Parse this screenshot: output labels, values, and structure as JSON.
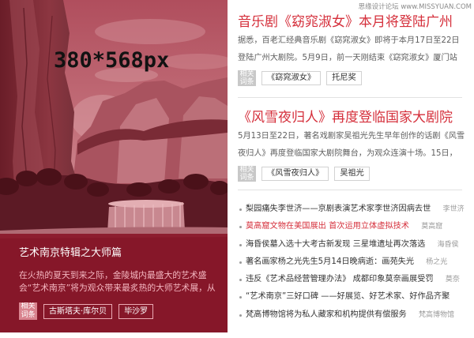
{
  "watermark": "思缘设计论坛 www.MISSYUAN.COM",
  "colors": {
    "accent": "#d52f3b",
    "caption_background": "#8a1729",
    "feature_tag_label": "#d9848f",
    "related_label": "#c8c8c8"
  },
  "feature": {
    "image_placeholder": "380*568px",
    "title": "艺术南京特辑之大师篇",
    "description_lines": [
      "在火热的夏天到来之际，金陵城内最盛大的艺术盛",
      "会“艺术南京”将为观众带来最炙热的大师艺术展，从"
    ],
    "related_label": "相关词条",
    "tags": [
      "古斯塔夫·库尔贝",
      "毕沙罗"
    ]
  },
  "articles": [
    {
      "title": "音乐剧《窈窕淑女》本月将登陆广州",
      "description_lines": [
        "据悉，百老汇经典音乐剧《窈窕淑女》即将于本月17日至22日",
        "登陆广州大剧院。5月9日，前一天刚结束《窈窕淑女》厦门站"
      ],
      "related_label": "相关词条",
      "tags": [
        "《窈窕淑女》",
        "托尼奖"
      ]
    },
    {
      "title": "《风雪夜归人》再度登临国家大剧院",
      "description_lines": [
        "5月13日至22日，著名戏剧家吴祖光先生早年创作的话剧《风雪",
        "夜归人》再度登临国家大剧院舞台，为观众连演十场。15日，"
      ],
      "related_label": "相关词条",
      "tags": [
        "《风雪夜归人》",
        "吴祖光"
      ]
    }
  ],
  "news_list": [
    {
      "title": "梨园痛失李世济——京剧表演艺术家李世济因病去世",
      "tag": "李世济",
      "highlighted": false
    },
    {
      "title": "莫高窟文物在美国展出 首次运用立体虚拟技术",
      "tag": "莫高窟",
      "highlighted": true
    },
    {
      "title": "海昏侯墓入选十大考古新发现 三星堆遗址再次落选",
      "tag": "海昏侯",
      "highlighted": false
    },
    {
      "title": "著名画家杨之光先生5月14日晚病逝：画苑失光",
      "tag": "杨之光",
      "highlighted": false
    },
    {
      "title": "违反《艺术品经营管理办法》 成都印象莫奈画展受罚",
      "tag": "莫奈",
      "highlighted": false
    },
    {
      "title": "“艺术南京”三好口碑 ——好展览、好艺术家、好作品齐聚",
      "highlighted": false
    },
    {
      "title": "梵高博物馆将为私人藏家和机构提供有偿服务",
      "tag": "梵高博物馆",
      "highlighted": false
    }
  ]
}
